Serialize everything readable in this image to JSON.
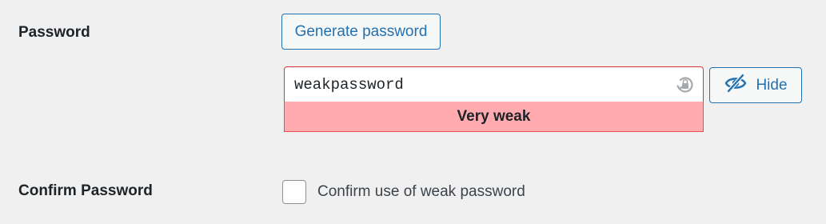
{
  "password_row": {
    "label": "Password",
    "generate_button_label": "Generate password",
    "password_value": "weakpassword",
    "strength_label": "Very weak",
    "hide_button_label": "Hide"
  },
  "confirm_row": {
    "label": "Confirm Password",
    "checkbox_label": "Confirm use of weak password",
    "checked": false
  },
  "icons": {
    "lock": "lock-icon",
    "hide": "eye-slash-icon"
  },
  "colors": {
    "accent": "#2271b1",
    "strength_bg": "#ffabaf",
    "error_border": "#d63638"
  }
}
